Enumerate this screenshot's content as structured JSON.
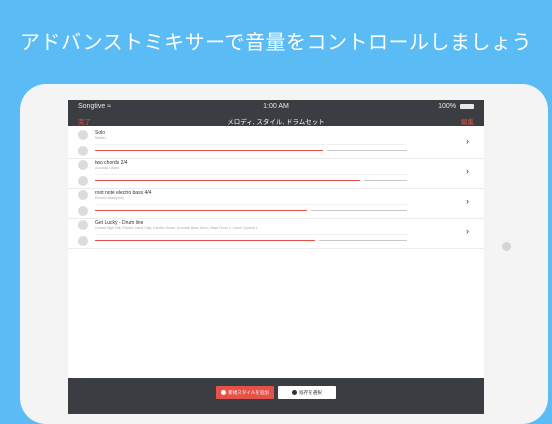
{
  "headline": "アドバンストミキサーで音量をコントロールしましょう",
  "status": {
    "carrier": "Songtive",
    "time": "1:00 AM",
    "battery": "100%"
  },
  "nav": {
    "done": "完了",
    "title": "メロディ, スタイル, ドラムセット",
    "edit": "編集"
  },
  "items": [
    {
      "title": "Solo",
      "subtitle": "Mirthel",
      "volume": 0.86
    },
    {
      "title": "two chords 2/4",
      "subtitle": "Acoustic Grand",
      "volume": 1.0
    },
    {
      "title": "root note electro bass 4/4",
      "subtitle": "Electric Bass(pick)",
      "volume": 0.8
    },
    {
      "title": "Get Lucky - Drum line",
      "subtitle": "Closed High Hat, Electric Hand Clap, Electric Snare, Acoustic Bass Drum, Bass Drum 1, Crash Cymbal 1",
      "volume": 0.83
    }
  ],
  "toolbar": {
    "new_style": "新規スタイルを追加",
    "select_existing": "既存を選択"
  },
  "colors": {
    "background": "#5bbcf5",
    "accent": "#e4524a",
    "bar": "#3a3d42"
  },
  "icons": {
    "wifi": "wifi-icon",
    "battery": "battery-icon",
    "chevron": "chevron-right-icon",
    "plus": "plus-circle-icon",
    "check": "check-circle-icon"
  }
}
